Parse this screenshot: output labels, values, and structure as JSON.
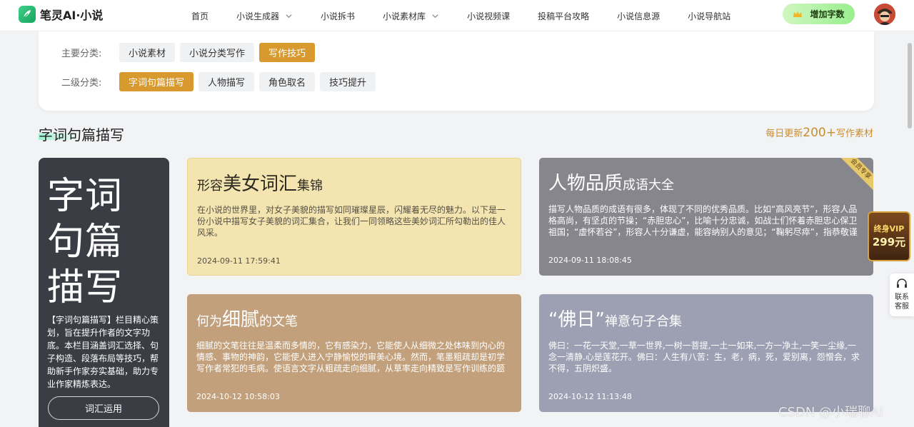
{
  "header": {
    "logo_text": "笔灵AI·小说",
    "nav": [
      {
        "label": "首页",
        "has_dropdown": false
      },
      {
        "label": "小说生成器",
        "has_dropdown": true
      },
      {
        "label": "小说拆书",
        "has_dropdown": false
      },
      {
        "label": "小说素材库",
        "has_dropdown": true
      },
      {
        "label": "小说视频课",
        "has_dropdown": false
      },
      {
        "label": "投稿平台攻略",
        "has_dropdown": false
      },
      {
        "label": "小说信息源",
        "has_dropdown": false
      },
      {
        "label": "小说导航站",
        "has_dropdown": false
      }
    ],
    "add_words_label": "增加字数"
  },
  "filter": {
    "primary_label": "主要分类:",
    "primary": [
      "小说素材",
      "小说分类写作",
      "写作技巧"
    ],
    "primary_active": 2,
    "secondary_label": "二级分类:",
    "secondary": [
      "字词句篇描写",
      "人物描写",
      "角色取名",
      "技巧提升"
    ],
    "secondary_active": 0
  },
  "section": {
    "title": "字词句篇描写",
    "update_prefix": "每日更新",
    "update_count": "200+",
    "update_suffix": "写作素材"
  },
  "side_card": {
    "big_text": "字词句篇描写",
    "description": "【字词句篇描写】栏目精心策划，旨在提升作者的文字功底。本栏目涵盖词汇选择、句子构造、段落布局等技巧，帮助新手作家夯实基础，助力专业作家精炼表达。",
    "button_label": "词汇运用"
  },
  "cards": [
    {
      "title_pre": "形容",
      "title_emph": "美女词汇",
      "title_post": "集锦",
      "description": "在小说的世界里，对女子美貌的描写如同璀璨星辰，闪耀着无尽的魅力。以下是一份小说中描写女子美貌的词汇集合，让我们一同领略这些美妙词汇所勾勒出的佳人风采。",
      "date": "2024-09-11 17:59:41",
      "ribbon": ""
    },
    {
      "title_pre": "",
      "title_emph": "人物品质",
      "title_post": "成语大全",
      "description": "描写人物品质的成语有很多，体现了不同的优秀品质。比如“高风亮节”，形容人品格高尚，有坚贞的节操；“赤胆忠心”，比喻十分忠诚，如战士们怀着赤胆忠心保卫祖国；“虚怀若谷”，形容人十分谦虚，能容纳别人的意见；“鞠躬尽瘁”，指恭敬谨慎，…",
      "date": "2024-09-11 18:08:45",
      "ribbon": "会员专享"
    },
    {
      "title_pre": "何为",
      "title_emph": "细腻",
      "title_post": "的文笔",
      "description": "细腻的文笔往往是温柔而多情的，它有感染力，它能使人从细微之处体味到内心的情感、事物的神韵，它能使人进入宁静愉悦的审美心境。然而，笔墨粗疏却是初学写作者常犯的毛病。使语言文字从粗疏走向细腻，从草率走向精致是写作训练的题中应…",
      "date": "2024-10-12 10:58:03",
      "ribbon": ""
    },
    {
      "title_pre": "",
      "title_emph": "“佛日”",
      "title_post": "禅意句子合集",
      "description": "佛曰：一花一天堂,一草一世界,一树一菩提,一土一如来,一方一净土,一笑一尘缘,一念一清静.心是莲花开。佛曰：人生有八苦：生，老，病，死，爱别离，怨憎会，求不得，五阴炽盛。",
      "date": "2024-10-12 11:13:48",
      "ribbon": ""
    }
  ],
  "floating": {
    "vip_line1": "终身VIP",
    "vip_line2": "299元",
    "support_label": "联系客服"
  },
  "watermark": "CSDN @小瑞聊AI",
  "colors": {
    "accent": "#d89a2e",
    "chip_bg": "#f0f1f3",
    "side_card_bg": "#3b3d45"
  }
}
